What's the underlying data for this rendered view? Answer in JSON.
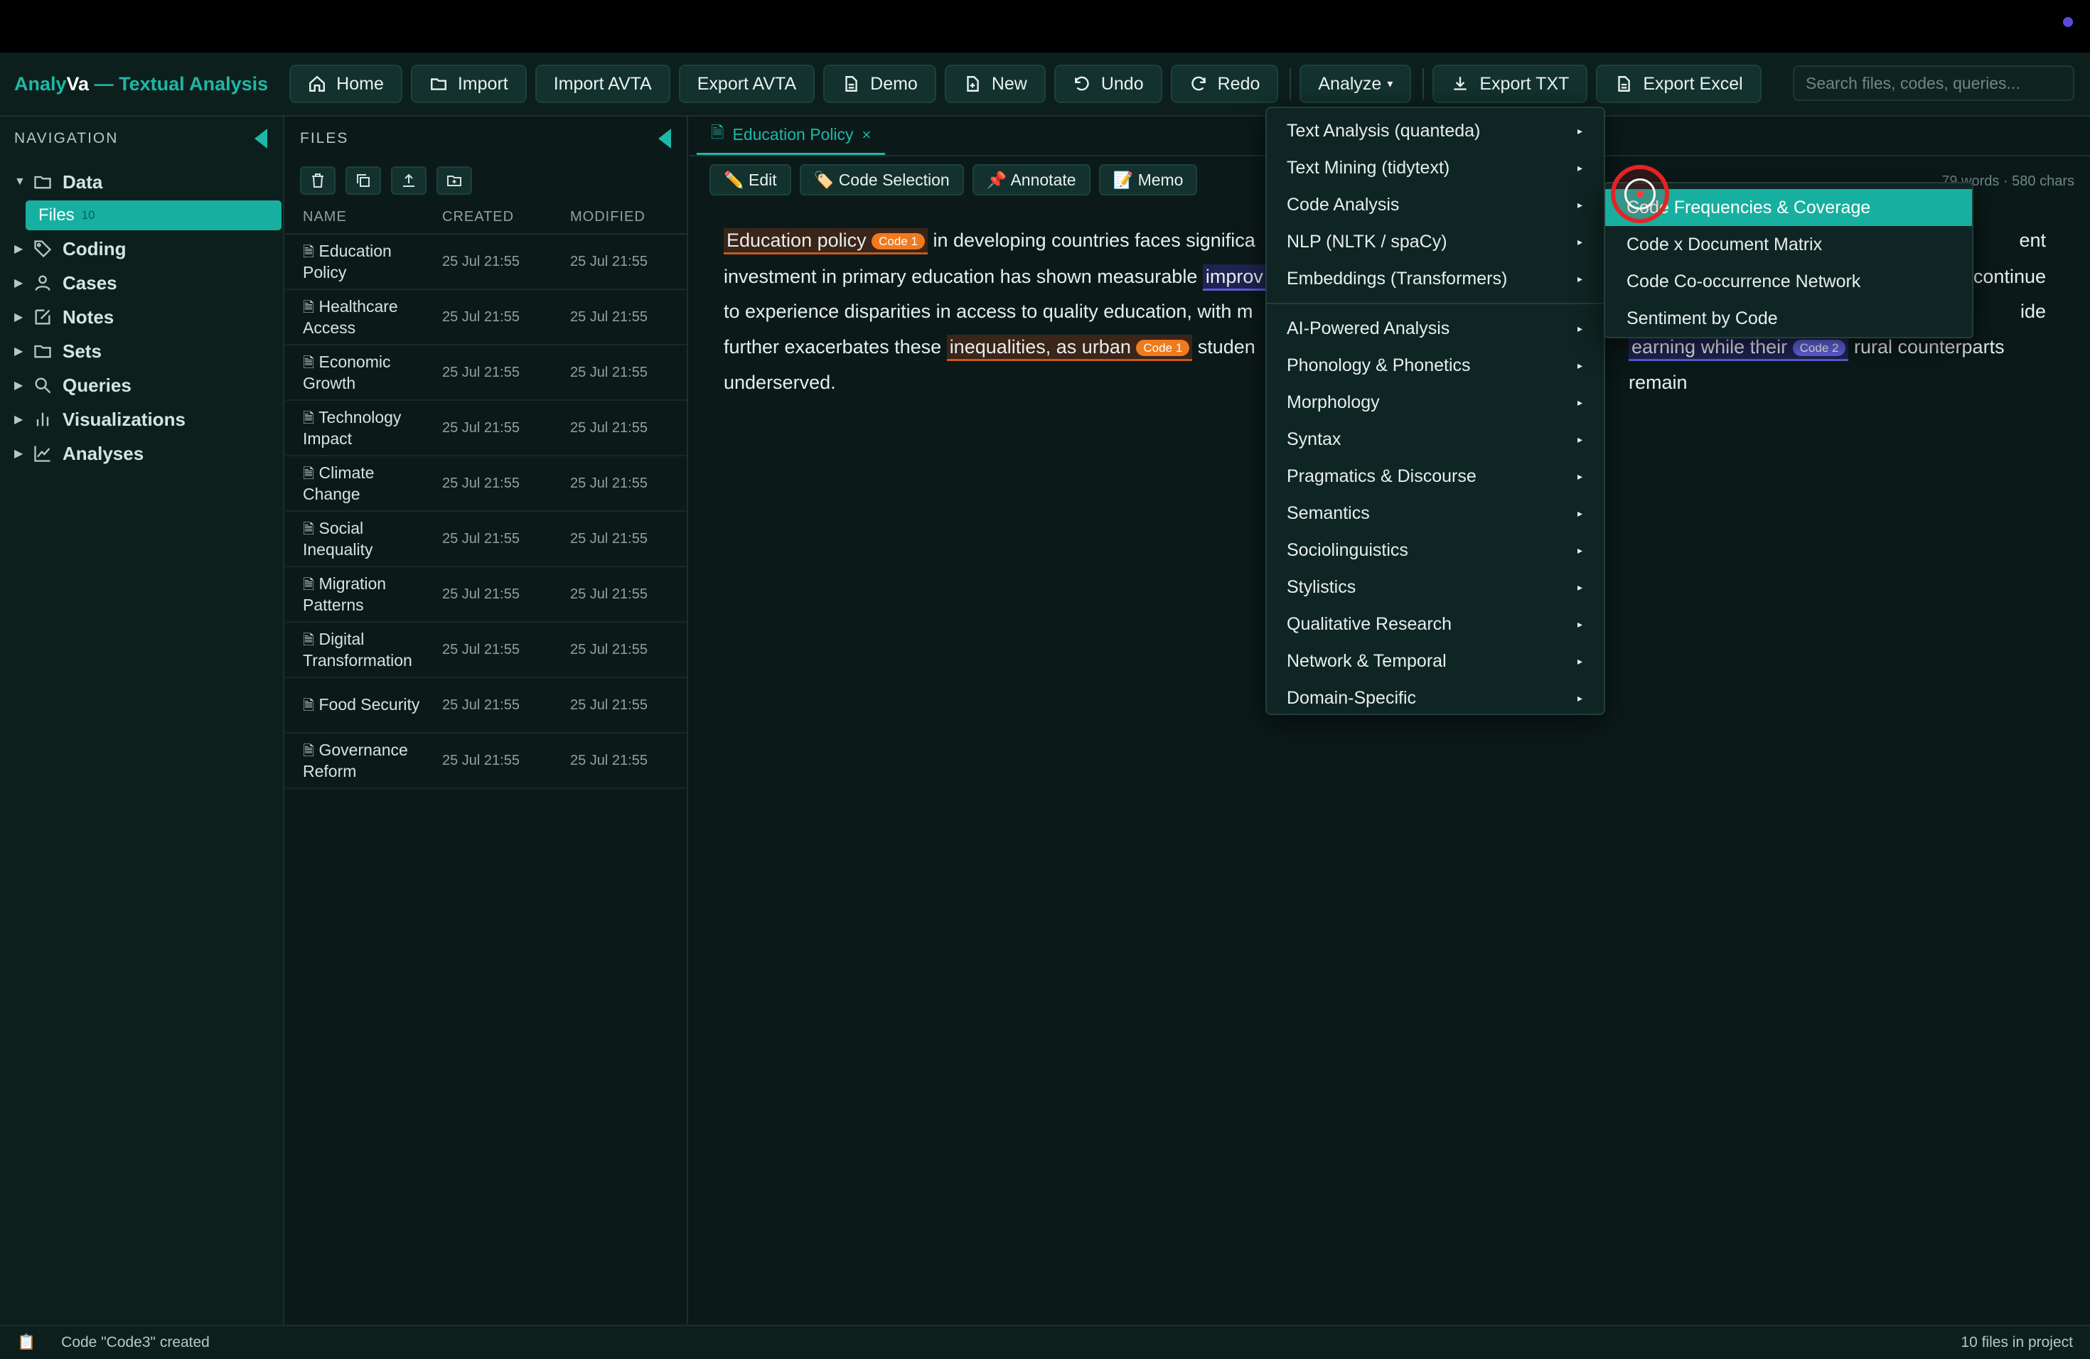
{
  "app": {
    "brand_prefix": "Analy",
    "brand_va": "Va",
    "brand_suffix": " — Textual Analysis"
  },
  "toolbar": {
    "home": "Home",
    "import": "Import",
    "import_avta": "Import AVTA",
    "export_avta": "Export AVTA",
    "demo": "Demo",
    "new": "New",
    "undo": "Undo",
    "redo": "Redo",
    "analyze": "Analyze",
    "export_txt": "Export TXT",
    "export_excel": "Export Excel",
    "search_placeholder": "Search files, codes, queries..."
  },
  "nav": {
    "title": "NAVIGATION",
    "items": [
      {
        "label": "Data",
        "icon": "folder-icon"
      },
      {
        "label": "Coding",
        "icon": "tag-icon"
      },
      {
        "label": "Cases",
        "icon": "user-icon"
      },
      {
        "label": "Notes",
        "icon": "edit-icon"
      },
      {
        "label": "Sets",
        "icon": "folder-icon"
      },
      {
        "label": "Queries",
        "icon": "search-icon"
      },
      {
        "label": "Visualizations",
        "icon": "bar-chart-icon"
      },
      {
        "label": "Analyses",
        "icon": "line-chart-icon"
      }
    ],
    "files_label": "Files",
    "files_count": "10"
  },
  "files": {
    "title": "FILES",
    "columns": [
      "NAME",
      "CREATED",
      "MODIFIED"
    ],
    "rows": [
      {
        "name": "Education Policy",
        "created": "25 Jul 21:55",
        "modified": "25 Jul 21:55"
      },
      {
        "name": "Healthcare Access",
        "created": "25 Jul 21:55",
        "modified": "25 Jul 21:55"
      },
      {
        "name": "Economic Growth",
        "created": "25 Jul 21:55",
        "modified": "25 Jul 21:55"
      },
      {
        "name": "Technology Impact",
        "created": "25 Jul 21:55",
        "modified": "25 Jul 21:55"
      },
      {
        "name": "Climate Change",
        "created": "25 Jul 21:55",
        "modified": "25 Jul 21:55"
      },
      {
        "name": "Social Inequality",
        "created": "25 Jul 21:55",
        "modified": "25 Jul 21:55"
      },
      {
        "name": "Migration Patterns",
        "created": "25 Jul 21:55",
        "modified": "25 Jul 21:55"
      },
      {
        "name": "Digital Transformation",
        "created": "25 Jul 21:55",
        "modified": "25 Jul 21:55"
      },
      {
        "name": "Food Security",
        "created": "25 Jul 21:55",
        "modified": "25 Jul 21:55"
      },
      {
        "name": "Governance Reform",
        "created": "25 Jul 21:55",
        "modified": "25 Jul 21:55"
      }
    ]
  },
  "editor": {
    "tab": "Education Policy",
    "tools": {
      "edit": "✏️ Edit",
      "code_selection": "🏷️ Code Selection",
      "annotate": "📌 Annotate",
      "memo": "📝 Memo"
    },
    "wordcount": "79 words · 580 chars",
    "text": {
      "l1_hl": "Education policy",
      "l1_badge": "Code 1",
      "l1_rest": " in developing countries faces significa",
      "l1_right": "ent",
      "l2a": "investment in primary education has shown measurable ",
      "l2_hl": "improv",
      "l2_right": "continue",
      "l3a": "to experience disparities in access to quality education, with m",
      "l3_right": "ide",
      "l4a": "further exacerbates these ",
      "l4_hl": " inequalities, as urban",
      "l4_badge": "Code 1",
      "l4b": " studen",
      "l4_hl2": "earning while their",
      "l4_badge2": "Code 2",
      "l4c": " rural counterparts remain",
      "l5": "underserved."
    }
  },
  "analyze_menu": {
    "items": [
      "Text Analysis (quanteda)",
      "Text Mining (tidytext)",
      "Code Analysis",
      "NLP (NLTK / spaCy)",
      "Embeddings (Transformers)",
      "AI-Powered Analysis",
      "Phonology & Phonetics",
      "Morphology",
      "Syntax",
      "Pragmatics & Discourse",
      "Semantics",
      "Sociolinguistics",
      "Stylistics",
      "Qualitative Research",
      "Network & Temporal",
      "Domain-Specific"
    ]
  },
  "code_analysis_submenu": {
    "items": [
      "Code Frequencies & Coverage",
      "Code x Document Matrix",
      "Code Co-occurrence Network",
      "Sentiment by Code"
    ],
    "active_index": 0
  },
  "status": {
    "message": "Code \"Code3\" created",
    "right": "10 files in project"
  },
  "colors": {
    "accent": "#1fb7a5",
    "code1": "#f07a1e",
    "code2": "#6465e5",
    "background": "#0b1a19"
  }
}
